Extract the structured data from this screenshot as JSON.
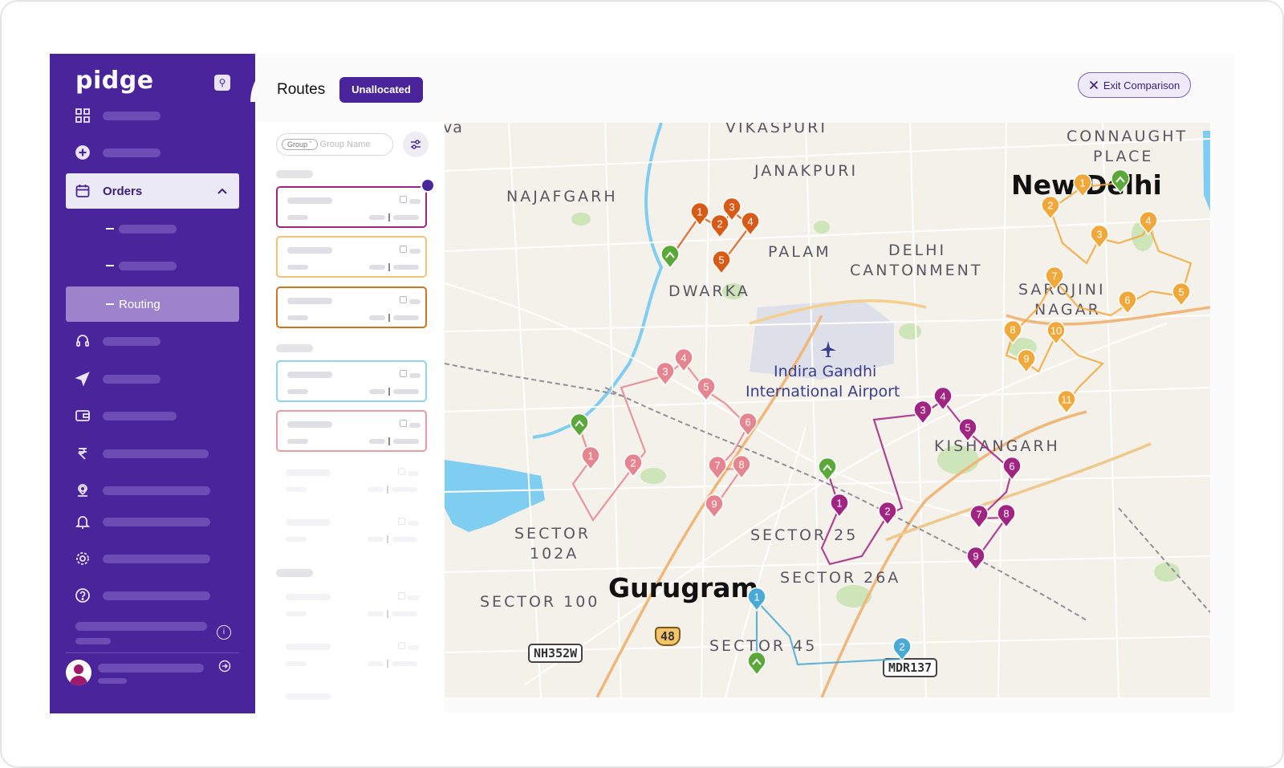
{
  "sidebar": {
    "logo": "pidge",
    "orders_label": "Orders",
    "routing_label": "Routing"
  },
  "header": {
    "title": "Routes",
    "unallocated_label": "Unallocated",
    "exit_label": "Exit Comparison"
  },
  "filter": {
    "group_chip": "Group",
    "placeholder": "Group Name"
  },
  "colors": {
    "brand": "#4a249a",
    "route_orange": "#d75a16",
    "route_amber": "#f1a83a",
    "route_pink": "#e4858f",
    "route_magenta": "#a02582",
    "route_blue": "#4aa9d5",
    "depot_green": "#5aa83a"
  },
  "map": {
    "places": {
      "vikaspuri": "VIKASPURI",
      "janakpuri": "JANAKPURI",
      "najafgarh": "NAJAFGARH",
      "palam": "PALAM",
      "dwarka": "DWARKA",
      "delhi_cant_1": "DELHI",
      "delhi_cant_2": "CANTONMENT",
      "connaught_1": "CONNAUGHT",
      "connaught_2": "PLACE",
      "new_delhi": "New Delhi",
      "sarojini_1": "SAROJINI",
      "sarojini_2": "NAGAR",
      "airport_1": "Indira Gandhi",
      "airport_2": "International Airport",
      "kishangarh": "KISHANGARH",
      "sector102a_1": "SECTOR",
      "sector102a_2": "102A",
      "sector25": "SECTOR 25",
      "sector26a": "SECTOR 26A",
      "sector100": "SECTOR 100",
      "gurugram": "Gurugram",
      "sector45": "SECTOR 45",
      "edge_va": "va"
    },
    "shields": {
      "nh": "NH352W",
      "mdr": "MDR137",
      "hw48": "48"
    },
    "routes": [
      {
        "name": "orange",
        "color": "#d75a16",
        "stops": [
          "1",
          "2",
          "3",
          "4",
          "5"
        ]
      },
      {
        "name": "amber",
        "color": "#f1a83a",
        "stops": [
          "1",
          "2",
          "3",
          "4",
          "5",
          "6",
          "7",
          "8",
          "9",
          "10",
          "11"
        ]
      },
      {
        "name": "pink",
        "color": "#e4858f",
        "stops": [
          "1",
          "2",
          "3",
          "4",
          "5",
          "6",
          "7",
          "8",
          "9"
        ]
      },
      {
        "name": "magenta",
        "color": "#a02582",
        "stops": [
          "1",
          "2",
          "3",
          "4",
          "5",
          "6",
          "7",
          "8",
          "9"
        ]
      },
      {
        "name": "blue",
        "color": "#4aa9d5",
        "stops": [
          "1",
          "2"
        ]
      }
    ]
  }
}
